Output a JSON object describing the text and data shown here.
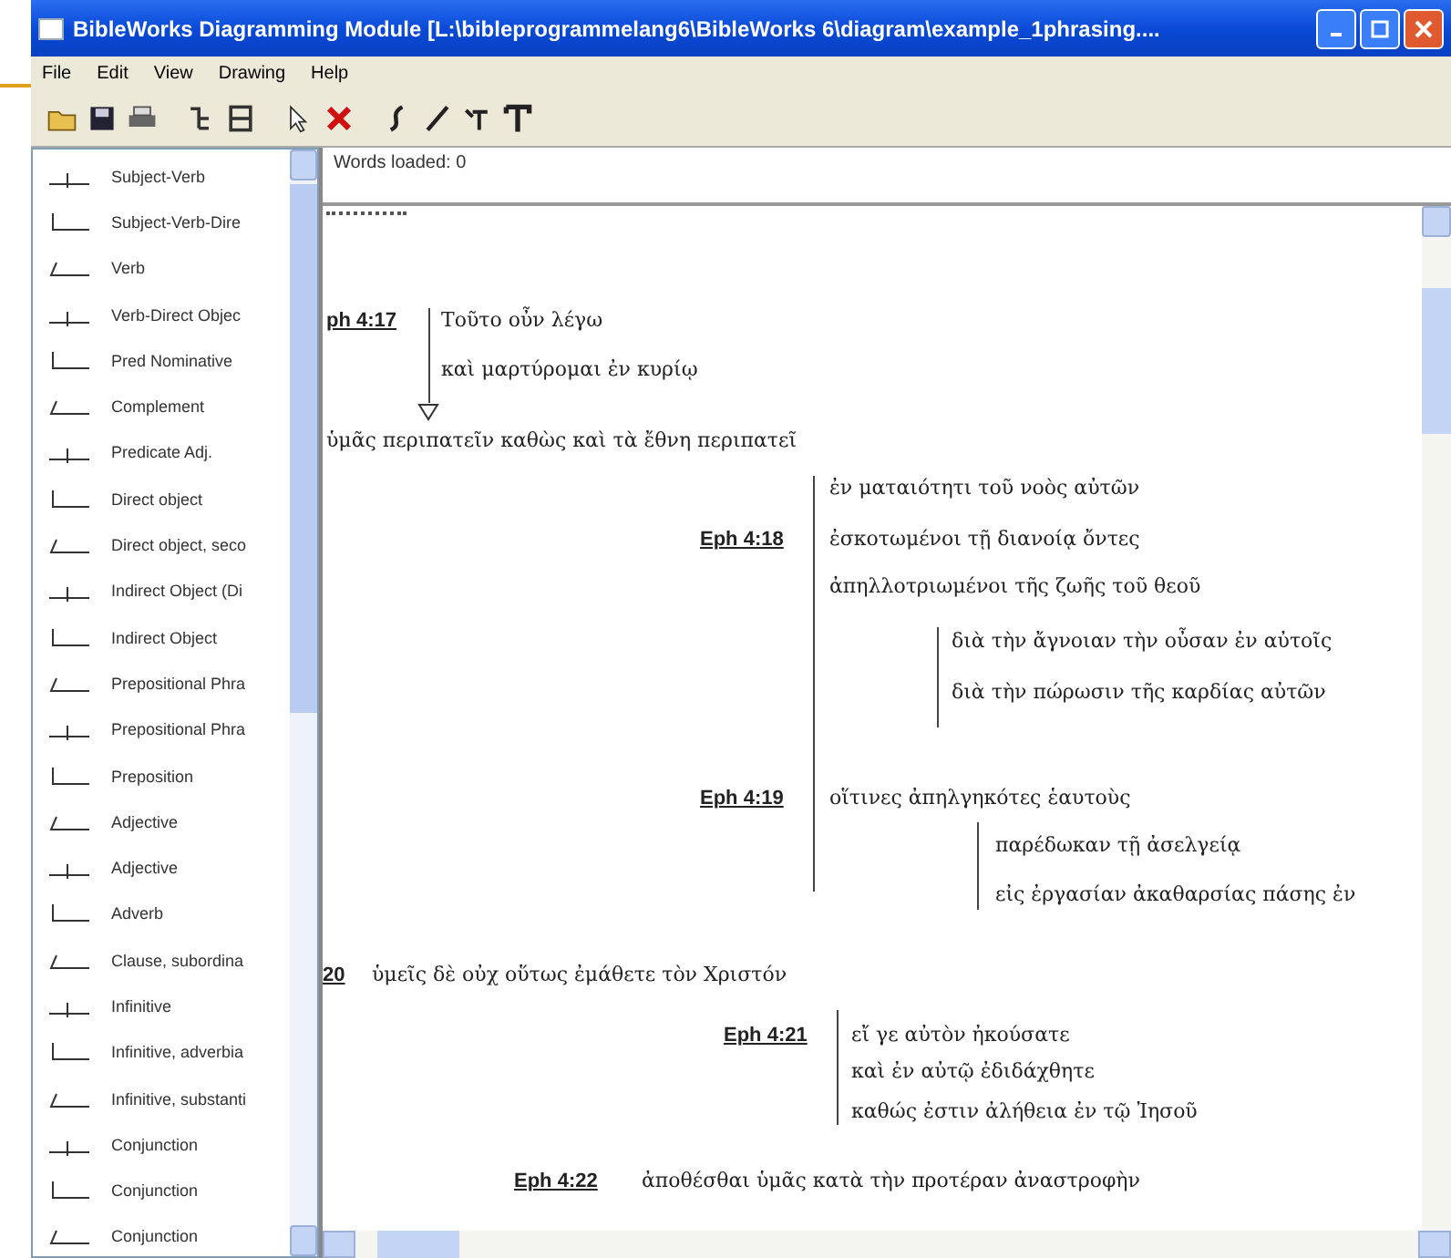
{
  "window": {
    "title": "BibleWorks Diagramming Module [L:\\bibleprogrammelang6\\BibleWorks 6\\diagram\\example_1phrasing...."
  },
  "menu": [
    "File",
    "Edit",
    "View",
    "Drawing",
    "Help"
  ],
  "sidebar": {
    "items": [
      {
        "label": "Subject-Verb"
      },
      {
        "label": "Subject-Verb-Dire"
      },
      {
        "label": "Verb"
      },
      {
        "label": "Verb-Direct Objec"
      },
      {
        "label": "Pred Nominative"
      },
      {
        "label": "Complement"
      },
      {
        "label": "Predicate Adj."
      },
      {
        "label": "Direct object"
      },
      {
        "label": "Direct object, seco"
      },
      {
        "label": "Indirect Object (Di"
      },
      {
        "label": "Indirect Object"
      },
      {
        "label": "Prepositional Phra"
      },
      {
        "label": "Prepositional Phra"
      },
      {
        "label": "Preposition"
      },
      {
        "label": "Adjective"
      },
      {
        "label": "Adjective"
      },
      {
        "label": "Adverb"
      },
      {
        "label": "Clause, subordina"
      },
      {
        "label": "Infinitive"
      },
      {
        "label": "Infinitive, adverbia"
      },
      {
        "label": "Infinitive, substanti"
      },
      {
        "label": "Conjunction"
      },
      {
        "label": "Conjunction"
      },
      {
        "label": "Conjunction"
      }
    ]
  },
  "status": "Words loaded: 0",
  "diagram": {
    "lines": [
      {
        "kind": "ref",
        "text": "ph 4:17"
      },
      {
        "kind": "greek",
        "text": "Τοῦτο οὖν λέγω"
      },
      {
        "kind": "greek",
        "text": "καὶ μαρτύρομαι ἐν κυρίῳ"
      },
      {
        "kind": "greek",
        "text": "ὑμᾶς περιπατεῖν καθὼς καὶ τὰ ἔθνη περιπατεῖ"
      },
      {
        "kind": "greek",
        "text": "ἐν ματαιότητι τοῦ νοὸς αὐτῶν"
      },
      {
        "kind": "ref",
        "text": "Eph 4:18"
      },
      {
        "kind": "greek",
        "text": "ἐσκοτωμένοι τῇ διανοίᾳ ὄντες"
      },
      {
        "kind": "greek",
        "text": "ἀπηλλοτριωμένοι τῆς ζωῆς τοῦ θεοῦ"
      },
      {
        "kind": "greek",
        "text": "διὰ τὴν ἄγνοιαν τὴν οὖσαν ἐν αὐτοῖς"
      },
      {
        "kind": "greek",
        "text": "διὰ τὴν πώρωσιν τῆς καρδίας αὐτῶν"
      },
      {
        "kind": "ref",
        "text": "Eph 4:19"
      },
      {
        "kind": "greek",
        "text": "οἵτινες ἀπηλγηκότες ἑαυτοὺς"
      },
      {
        "kind": "greek",
        "text": "παρέδωκαν τῇ ἀσελγείᾳ"
      },
      {
        "kind": "greek",
        "text": "εἰς ἐργασίαν ἀκαθαρσίας πάσης ἐν"
      },
      {
        "kind": "ref",
        "text": "20"
      },
      {
        "kind": "greek",
        "text": "ὑμεῖς δὲ οὐχ οὕτως ἐμάθετε τὸν Χριστόν"
      },
      {
        "kind": "ref",
        "text": "Eph 4:21"
      },
      {
        "kind": "greek",
        "text": "εἴ γε αὐτὸν ἠκούσατε"
      },
      {
        "kind": "greek",
        "text": "καὶ ἐν αὐτῷ ἐδιδάχθητε"
      },
      {
        "kind": "greek",
        "text": "καθώς ἐστιν ἀλήθεια ἐν τῷ Ἰησοῦ"
      },
      {
        "kind": "ref",
        "text": "Eph 4:22"
      },
      {
        "kind": "greek",
        "text": "ἀποθέσθαι ὑμᾶς κατὰ τὴν προτέραν ἀναστροφὴν"
      }
    ]
  }
}
